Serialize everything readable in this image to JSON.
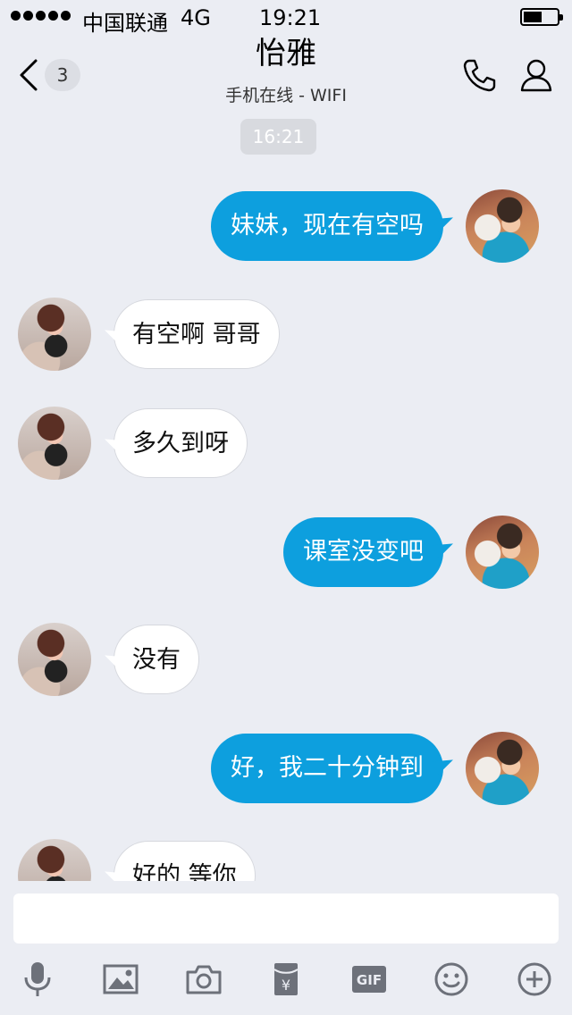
{
  "status_bar": {
    "carrier": "中国联通",
    "network": "4G",
    "time": "19:21",
    "battery_level": 0.55
  },
  "nav": {
    "unread_count": "3",
    "title": "怡雅",
    "subtitle": "手机在线 - WIFI"
  },
  "timestamp": "16:21",
  "messages": [
    {
      "from": "me",
      "text": "妹妹，现在有空吗"
    },
    {
      "from": "her",
      "text": "有空啊 哥哥"
    },
    {
      "from": "her",
      "text": "多久到呀"
    },
    {
      "from": "me",
      "text": "课室没变吧"
    },
    {
      "from": "her",
      "text": "没有"
    },
    {
      "from": "me",
      "text": "好，我二十分钟到"
    },
    {
      "from": "her",
      "text": "好的 等你"
    }
  ],
  "toolbar": {
    "icons": [
      "microphone-icon",
      "image-icon",
      "camera-icon",
      "red-packet-icon",
      "gif-icon",
      "emoji-icon",
      "plus-icon"
    ],
    "gif_label": "GIF"
  },
  "colors": {
    "background": "#ebedf3",
    "outgoing_bubble": "#0d9fde",
    "incoming_bubble": "#ffffff",
    "icon": "#6d717a"
  }
}
